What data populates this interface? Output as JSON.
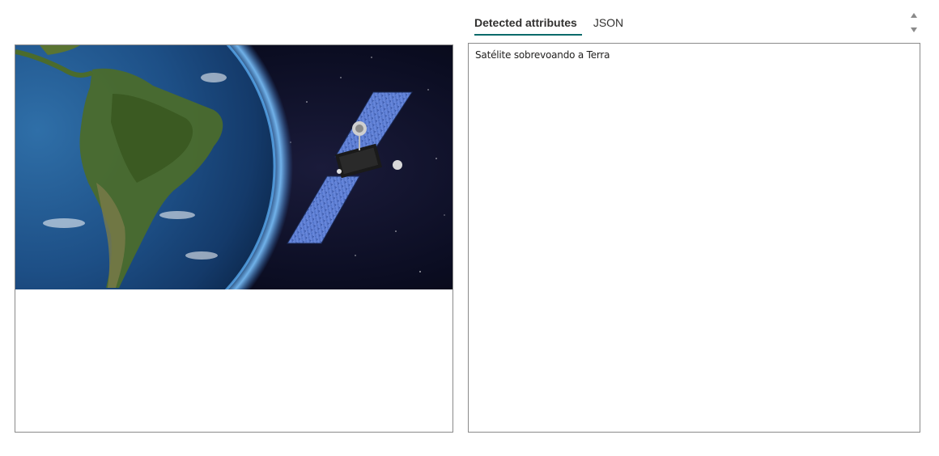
{
  "image": {
    "alt_subject": "satellite-over-earth-image"
  },
  "tabs": [
    {
      "label": "Detected attributes",
      "active": true
    },
    {
      "label": "JSON",
      "active": false
    }
  ],
  "result": {
    "caption": "Satélite sobrevoando a Terra"
  },
  "colors": {
    "tab_underline": "#0b6a6a",
    "border": "#8a8a8a",
    "space": "#0a0f24"
  },
  "icons": {
    "scroll": "spin-arrows-icon"
  }
}
